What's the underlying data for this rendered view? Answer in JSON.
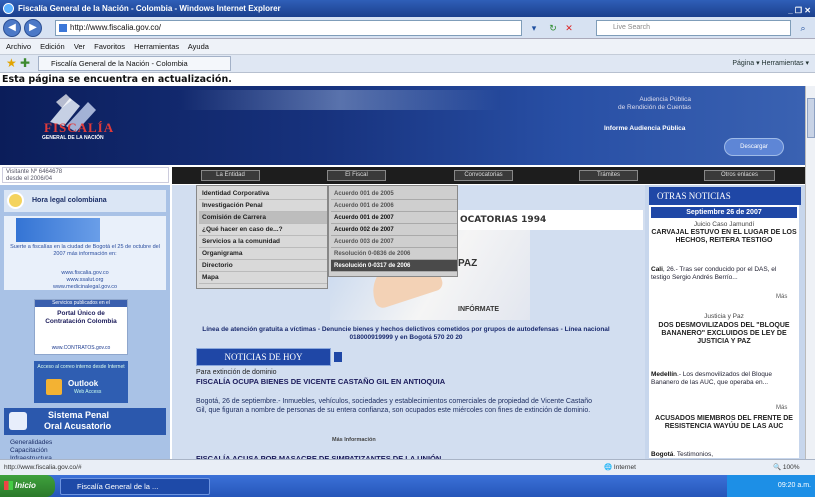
{
  "window": {
    "title": "Fiscalía General de la Nación - Colombia - Windows Internet Explorer",
    "controls": "_ ❐ ✕"
  },
  "address": {
    "url": "http://www.fiscalia.gov.co/",
    "search_placeholder": "Live Search"
  },
  "menu": [
    "Archivo",
    "Edición",
    "Ver",
    "Favoritos",
    "Herramientas",
    "Ayuda"
  ],
  "favorites": {
    "tab_title": "Fiscalía General de la Nación - Colombia",
    "tools": "Página ▾   Herramientas ▾"
  },
  "page": {
    "update_notice": "Esta página se encuentra en actualización.",
    "logo_name": "FISCALÍA",
    "logo_sub": "GENERAL DE LA NACIÓN",
    "banner_line1": "Audiencia Pública",
    "banner_line2": "de Rendición de Cuentas",
    "banner_link": "Informe Audiencia Pública",
    "banner_button": "Descargar",
    "visits_line1": "Visitante Nº 6464678",
    "visits_line2": "desde el 2006/04",
    "nav": [
      "La Entidad",
      "El Fiscal",
      "Convocatorias",
      "Trámites",
      "Otros enlaces"
    ]
  },
  "left": {
    "hora": "Hora legal colombiana",
    "promo_img": "Fiscalía",
    "promo_text": "Suerte a fiscalías en la ciudad de Bogotá el 25 de octubre del 2007 más información en:",
    "promo_links": "www.fiscalia.gov.co\nwww.ssalut.org\nwww.medicinalegal.gov.co",
    "contrat_hdr": "Servicios publicados en el",
    "contrat_title": "Portal Único de Contratación Colombia",
    "contrat_url": "www.CONTRATOS.gov.co",
    "outlook_hdr": "Acceso al correo interno desde Internet",
    "outlook_title": "Outlook",
    "outlook_sub": "Web Access",
    "spoa_line1": "Sistema Penal",
    "spoa_line2": "Oral Acusatorio",
    "spoa_links": [
      "Generalidades",
      "Capacitación",
      "Infraestructura"
    ]
  },
  "dropdown": {
    "items": [
      "Identidad Corporativa",
      "Investigación Penal",
      "Comisión de Carrera",
      "¿Qué hacer en caso de...?",
      "Servicios a la comunidad",
      "Organigrama",
      "Directorio",
      "Mapa"
    ],
    "sub_items": [
      "Acuerdo 001 de 2005",
      "Acuerdo 001 de 2006",
      "Acuerdo 001 de 2007",
      "Acuerdo 002 de 2007",
      "Acuerdo 003 de 2007",
      "Resolución 0-0836 de 2006",
      "Resolución 0-0317 de 2006"
    ]
  },
  "center": {
    "convocatorias": "OCATORIAS 1994",
    "image_text": "PAZ",
    "image_sub": "INFÓRMATE",
    "linea": "Línea de atención gratuita a víctimas - Denuncie bienes y hechos delictivos cometidos por grupos de autodefensas - Línea nacional 018000919999 y en Bogotá 570 20 20",
    "noticias_hoy": "NOTICIAS DE HOY",
    "news1_pre": "Para extinción de dominio",
    "news1_title": "FISCALÍA OCUPA BIENES DE VICENTE CASTAÑO GIL EN ANTIOQUIA",
    "news1_body": "Bogotá, 26 de septiembre.- Inmuebles, vehículos, sociedades y establecimientos comerciales de propiedad de Vicente Castaño Gil, que figuran a nombre de personas de su entera confianza, son ocupados este miércoles con fines de extinción de dominio.",
    "mas_info": "Más Información",
    "news2_title": "FISCALÍA ACUSA POR MASACRE DE SIMPATIZANTES DE LA UNIÓN"
  },
  "right": {
    "otras": "OTRAS NOTICIAS",
    "date": "Septiembre 26 de 2007",
    "n1_sub": "Juicio Caso Jamundí",
    "n1_head": "CARVAJAL ESTUVO EN EL LUGAR DE LOS HECHOS, REITERA TESTIGO",
    "n1_city": "Cali",
    "n1_body": ", 26.- Tras ser conducido por el DAS, el testigo Sergio Andrés Berrío...",
    "mas": "Más",
    "n2_sub": "Justicia y Paz",
    "n2_head": "DOS DESMOVILIZADOS DEL \"BLOQUE BANANERO\" EXCLUIDOS DE LEY DE JUSTICIA Y PAZ",
    "n2_city": "Medellín",
    "n2_body": ".- Los desmovilizados del Bloque Bananero de las AUC, que operaba en...",
    "n3_head": "ACUSADOS MIEMBROS DEL FRENTE DE RESISTENCIA WAYÚU DE LAS AUC",
    "n3_city": "Bogotá",
    "n3_body": ".          Testimonios,"
  },
  "status": {
    "url": "http://www.fiscalia.gov.co/#",
    "zone": "Internet",
    "zoom": "100%"
  },
  "taskbar": {
    "start": "Inicio",
    "item": "Fiscalía General de la ...",
    "time": "09:20 a.m."
  }
}
